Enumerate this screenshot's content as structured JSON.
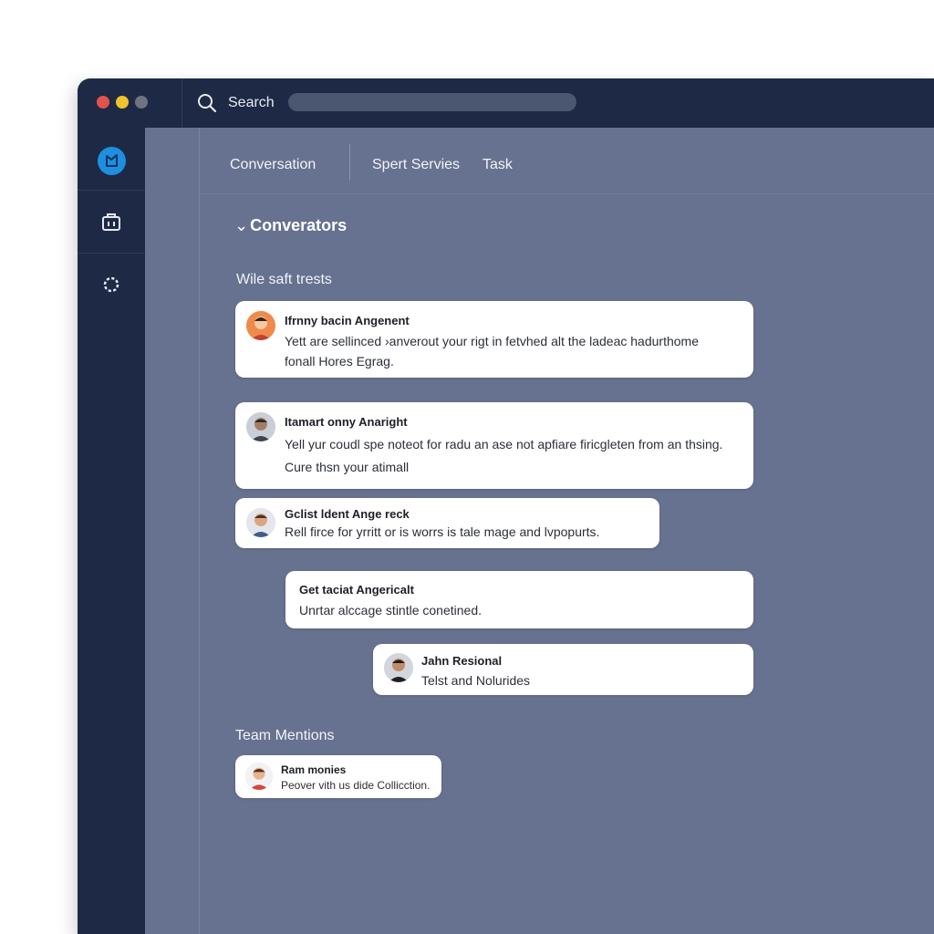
{
  "titlebar": {
    "search_label": "Search",
    "search_placeholder": ""
  },
  "sidebar": {
    "items": [
      {
        "icon": "app-logo-icon",
        "color": "#1e8fe0"
      },
      {
        "icon": "briefcase-icon"
      },
      {
        "icon": "settings-icon"
      }
    ]
  },
  "tabs": [
    {
      "label": "Conversation"
    },
    {
      "label": "Spert Servies"
    },
    {
      "label": "Task"
    }
  ],
  "main": {
    "section_title": "Converators",
    "subsection_title": "Wile saft trests",
    "messages": [
      {
        "name": "Ifrnny bacin Angenent",
        "lines": [
          "Yett are sellinced ›anverout your rigt in fetvhed alt the ladeac hadurthome",
          "fonall Hores Egrag."
        ]
      },
      {
        "name": "Itamart onny Anaright",
        "lines": [
          "Yell yur coudl spe noteot for radu an ase not apfiare firicgleten from an thsing.",
          "Cure thsn your atimall"
        ]
      },
      {
        "name": "Gclist ldent Ange reck",
        "lines": [
          "Rell firce for yrritt or is worrs is tale mage and lvpopurts."
        ]
      },
      {
        "name": "Get taciat Angericalt",
        "lines": [
          "Unrtar alccage stintle conetined."
        ]
      },
      {
        "name": "Jahn Resional",
        "lines": [
          "Telst and Nolurides"
        ]
      }
    ],
    "team_title": "Team Mentions",
    "mentions": [
      {
        "name": "Ram monies",
        "lines": [
          "Peover vith us dide Collicction."
        ]
      }
    ]
  },
  "colors": {
    "window_bg": "#66728f",
    "chrome_bg": "#1e2a45",
    "accent": "#1e8fe0"
  }
}
